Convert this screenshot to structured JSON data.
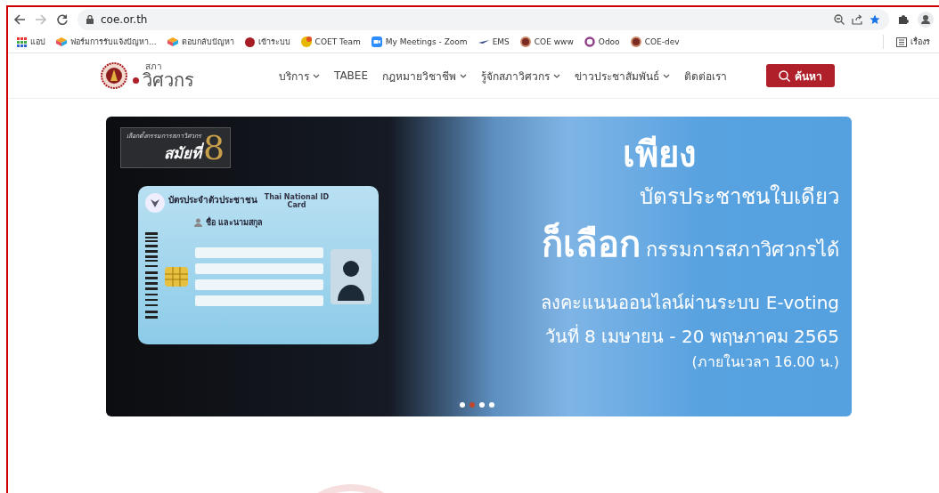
{
  "browser": {
    "url": "coe.or.th",
    "bookmarks": [
      {
        "label": "แอป",
        "kind": "apps"
      },
      {
        "label": "ฟอร์มการรับแจ้งปัญหา...",
        "kind": "form"
      },
      {
        "label": "ตอบกลับปัญหา",
        "kind": "form"
      },
      {
        "label": "เข้าระบบ",
        "kind": "dot"
      },
      {
        "label": "COET Team",
        "kind": "smiley"
      },
      {
        "label": "My Meetings - Zoom",
        "kind": "zoom"
      },
      {
        "label": "EMS",
        "kind": "ems"
      },
      {
        "label": "COE www",
        "kind": "seal"
      },
      {
        "label": "Odoo",
        "kind": "odoo"
      },
      {
        "label": "COE-dev",
        "kind": "seal"
      }
    ],
    "reading_list": "เรื่องร"
  },
  "site": {
    "logo": {
      "line1": "สภา",
      "line2": "วิศวกร"
    },
    "nav": [
      {
        "label": "บริการ",
        "dropdown": true
      },
      {
        "label": "TABEE",
        "dropdown": false
      },
      {
        "label": "กฎหมายวิชาชีพ",
        "dropdown": true
      },
      {
        "label": "รู้จักสภาวิศวกร",
        "dropdown": true
      },
      {
        "label": "ข่าวประชาสัมพันธ์",
        "dropdown": true
      },
      {
        "label": "ติดต่อเรา",
        "dropdown": false
      }
    ],
    "search_button": "ค้นหา"
  },
  "banner": {
    "badge": {
      "caption": "เลือกตั้งกรรมการสภาวิศวกร",
      "title": "สมัยที่",
      "number": "8"
    },
    "id_card": {
      "title_th": "บัตรประจำตัวประชาชน",
      "title_en": "Thai National ID Card",
      "name_label": "ชื่อ และนามสกุล"
    },
    "headline": "เพียง",
    "line2": "บัตรประชาชนใบเดียว",
    "line3_big": "ก็เลือก",
    "line3_small": "กรรมการสภาวิศวกรได้",
    "line4": "ลงคะแนนออนไลน์ผ่านระบบ E-voting",
    "line5": "วันที่ 8 เมษายน - 20 พฤษภาคม 2565",
    "line6": "(ภายในเวลา 16.00 น.)",
    "dots": [
      {
        "selected": false
      },
      {
        "selected": true
      },
      {
        "selected": false
      },
      {
        "selected": false
      }
    ]
  }
}
